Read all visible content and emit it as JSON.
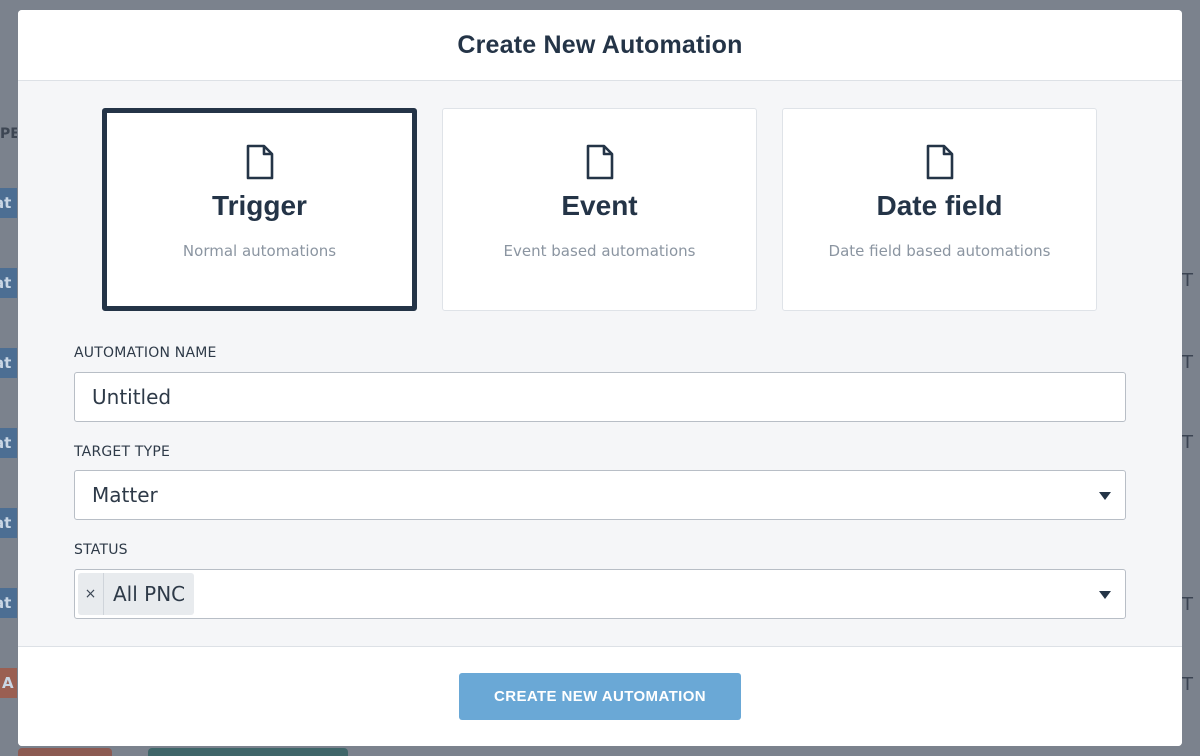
{
  "modal": {
    "title": "Create New Automation",
    "cards": [
      {
        "icon": "document-icon",
        "title": "Trigger",
        "subtitle": "Normal automations",
        "selected": true
      },
      {
        "icon": "document-icon",
        "title": "Event",
        "subtitle": "Event based automations",
        "selected": false
      },
      {
        "icon": "document-icon",
        "title": "Date field",
        "subtitle": "Date field based automations",
        "selected": false
      }
    ],
    "fields": {
      "name_label": "AUTOMATION NAME",
      "name_value": "Untitled",
      "target_label": "TARGET TYPE",
      "target_value": "Matter",
      "status_label": "STATUS",
      "status_chip": "All PNC",
      "status_chip_remove": "×"
    },
    "submit_label": "CREATE NEW AUTOMATION"
  },
  "background": {
    "left_header": "PE",
    "left_tags": [
      "at",
      "at",
      "at",
      "at",
      "at",
      "at",
      "A"
    ],
    "right_text": [
      "T",
      "T",
      "T",
      "T",
      "T"
    ]
  },
  "colors": {
    "primary": "#6aa8d6",
    "text_dark": "#243447",
    "overlay": "#6f7682"
  }
}
